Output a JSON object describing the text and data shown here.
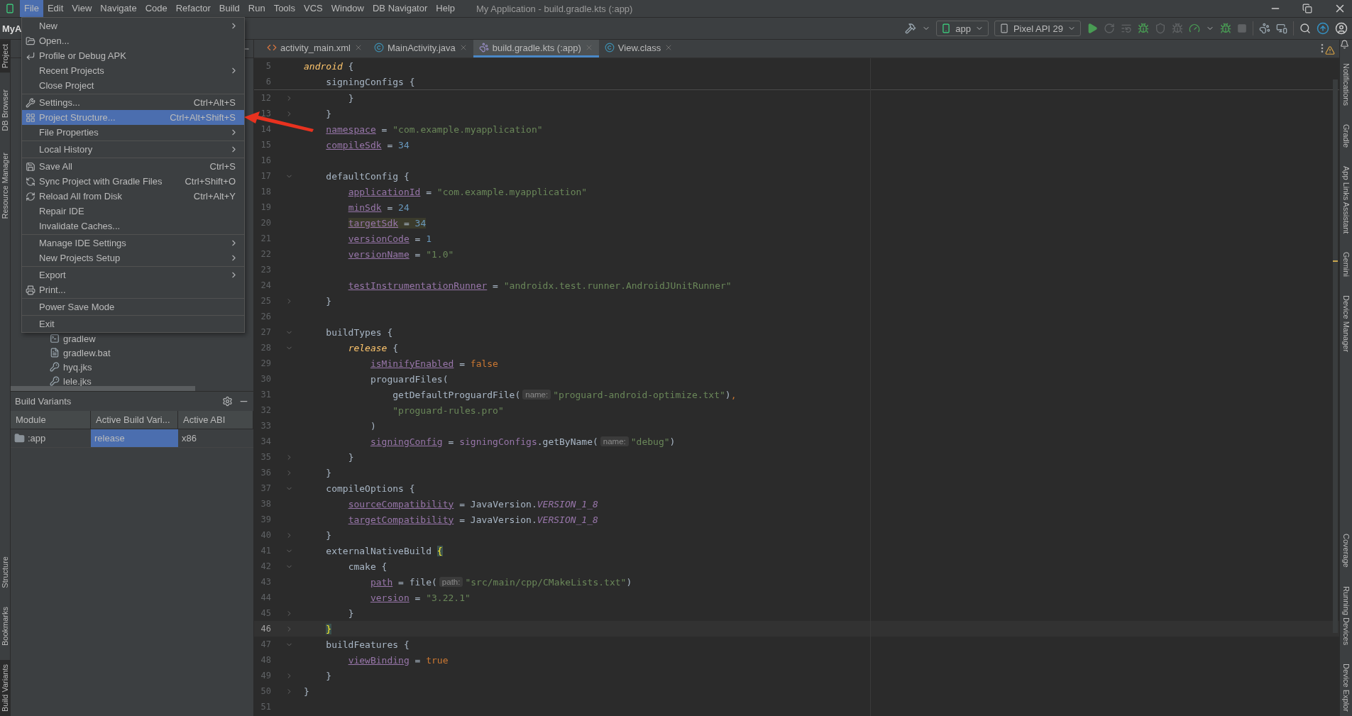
{
  "menu_bar": {
    "items": [
      {
        "label": "File",
        "selected": true
      },
      {
        "label": "Edit",
        "selected": false
      },
      {
        "label": "View",
        "selected": false
      },
      {
        "label": "Navigate",
        "selected": false
      },
      {
        "label": "Code",
        "selected": false
      },
      {
        "label": "Refactor",
        "selected": false
      },
      {
        "label": "Build",
        "selected": false
      },
      {
        "label": "Run",
        "selected": false
      },
      {
        "label": "Tools",
        "selected": false
      },
      {
        "label": "VCS",
        "selected": false
      },
      {
        "label": "Window",
        "selected": false
      },
      {
        "label": "DB Navigator",
        "selected": false
      },
      {
        "label": "Help",
        "selected": false
      }
    ],
    "title": "My Application - build.gradle.kts (:app)"
  },
  "toolbar": {
    "project": "MyA",
    "run_config": "app",
    "device": "Pixel API 29"
  },
  "left_tool_strip": {
    "top": [
      {
        "label": "Project",
        "selected": true
      },
      {
        "label": "DB Browser",
        "selected": false
      },
      {
        "label": "Resource Manager",
        "selected": false
      }
    ],
    "bottom": [
      {
        "label": "Structure",
        "selected": false
      },
      {
        "label": "Bookmarks",
        "selected": false
      },
      {
        "label": "Build Variants",
        "selected": true
      }
    ]
  },
  "project_tree": {
    "items": [
      {
        "label": "gradlew",
        "kind": "script"
      },
      {
        "label": "gradlew.bat",
        "kind": "text"
      },
      {
        "label": "hyq.jks",
        "kind": "keystore"
      },
      {
        "label": "lele.jks",
        "kind": "keystore"
      }
    ]
  },
  "build_variants": {
    "title": "Build Variants",
    "columns": [
      "Module",
      "Active Build Vari...",
      "Active ABI"
    ],
    "rows": [
      {
        "module": ":app",
        "variant": "release",
        "abi": "x86",
        "selected": true
      }
    ]
  },
  "file_menu": {
    "groups": [
      [
        {
          "label": "New",
          "submenu": true,
          "selected": false
        },
        {
          "label": "Open...",
          "submenu": false,
          "selected": false
        },
        {
          "label": "Profile or Debug APK",
          "submenu": false,
          "selected": false
        },
        {
          "label": "Recent Projects",
          "submenu": true,
          "selected": false
        },
        {
          "label": "Close Project",
          "submenu": false,
          "selected": false
        }
      ],
      [
        {
          "label": "Settings...",
          "shortcut": "Ctrl+Alt+S",
          "submenu": false,
          "selected": false
        },
        {
          "label": "Project Structure...",
          "shortcut": "Ctrl+Alt+Shift+S",
          "submenu": false,
          "selected": true
        },
        {
          "label": "File Properties",
          "submenu": true,
          "selected": false
        }
      ],
      [
        {
          "label": "Local History",
          "submenu": true,
          "selected": false
        }
      ],
      [
        {
          "label": "Save All",
          "shortcut": "Ctrl+S",
          "submenu": false,
          "selected": false
        },
        {
          "label": "Sync Project with Gradle Files",
          "shortcut": "Ctrl+Shift+O",
          "submenu": false,
          "selected": false
        },
        {
          "label": "Reload All from Disk",
          "shortcut": "Ctrl+Alt+Y",
          "submenu": false,
          "selected": false
        },
        {
          "label": "Repair IDE",
          "submenu": false,
          "selected": false
        },
        {
          "label": "Invalidate Caches...",
          "submenu": false,
          "selected": false
        }
      ],
      [
        {
          "label": "Manage IDE Settings",
          "submenu": true,
          "selected": false
        },
        {
          "label": "New Projects Setup",
          "submenu": true,
          "selected": false
        }
      ],
      [
        {
          "label": "Export",
          "submenu": true,
          "selected": false
        },
        {
          "label": "Print...",
          "submenu": false,
          "selected": false
        }
      ],
      [
        {
          "label": "Power Save Mode",
          "submenu": false,
          "selected": false
        }
      ],
      [
        {
          "label": "Exit",
          "submenu": false,
          "selected": false
        }
      ]
    ]
  },
  "editor": {
    "tabs": [
      {
        "label": "activity_main.xml",
        "kind": "xml",
        "selected": false
      },
      {
        "label": "MainActivity.java",
        "kind": "class",
        "selected": false
      },
      {
        "label": "build.gradle.kts (:app)",
        "kind": "gradle",
        "selected": true
      },
      {
        "label": "View.class",
        "kind": "class",
        "selected": false
      }
    ],
    "sticky_lines": [
      {
        "number": "5",
        "tokens": [
          {
            "kind": "fn",
            "text": "android"
          },
          {
            "kind": "plain",
            "text": " {"
          }
        ]
      },
      {
        "number": "6",
        "tokens": [
          {
            "kind": "plain",
            "text": "    signingConfigs {"
          }
        ]
      }
    ],
    "lines": [
      {
        "number": "12",
        "kind": "close",
        "tokens": [
          {
            "kind": "plain",
            "text": "        }"
          }
        ]
      },
      {
        "number": "13",
        "kind": "close",
        "tokens": [
          {
            "kind": "plain",
            "text": "    }"
          }
        ]
      },
      {
        "number": "14",
        "kind": "plain",
        "tokens": [
          {
            "kind": "prop",
            "text": "    namespace"
          },
          {
            "kind": "plain",
            "text": " = "
          },
          {
            "kind": "str",
            "text": "\"com.example.myapplication\""
          }
        ]
      },
      {
        "number": "15",
        "kind": "plain",
        "tokens": [
          {
            "kind": "prop",
            "text": "    compileSdk"
          },
          {
            "kind": "plain",
            "text": " = "
          },
          {
            "kind": "num",
            "text": "34"
          }
        ]
      },
      {
        "number": "16",
        "kind": "blank"
      },
      {
        "number": "17",
        "kind": "open",
        "tokens": [
          {
            "kind": "plain",
            "text": "    defaultConfig {"
          }
        ]
      },
      {
        "number": "18",
        "kind": "plain",
        "tokens": [
          {
            "kind": "prop",
            "text": "        applicationId"
          },
          {
            "kind": "plain",
            "text": " = "
          },
          {
            "kind": "str",
            "text": "\"com.example.myapplication\""
          }
        ]
      },
      {
        "number": "19",
        "kind": "plain",
        "tokens": [
          {
            "kind": "prop",
            "text": "        minSdk"
          },
          {
            "kind": "plain",
            "text": " = "
          },
          {
            "kind": "num",
            "text": "24"
          }
        ]
      },
      {
        "number": "20",
        "kind": "plain",
        "marked": true,
        "tokens": [
          {
            "kind": "prop",
            "text": "        targetSdk"
          },
          {
            "kind": "plain",
            "text": " = "
          },
          {
            "kind": "num",
            "text": "34"
          }
        ]
      },
      {
        "number": "21",
        "kind": "plain",
        "tokens": [
          {
            "kind": "prop",
            "text": "        versionCode"
          },
          {
            "kind": "plain",
            "text": " = "
          },
          {
            "kind": "num",
            "text": "1"
          }
        ]
      },
      {
        "number": "22",
        "kind": "plain",
        "tokens": [
          {
            "kind": "prop",
            "text": "        versionName"
          },
          {
            "kind": "plain",
            "text": " = "
          },
          {
            "kind": "str",
            "text": "\"1.0\""
          }
        ]
      },
      {
        "number": "23",
        "kind": "blank"
      },
      {
        "number": "24",
        "kind": "plain",
        "tokens": [
          {
            "kind": "prop",
            "text": "        testInstrumentationRunner"
          },
          {
            "kind": "plain",
            "text": " = "
          },
          {
            "kind": "str",
            "text": "\"androidx.test.runner.AndroidJUnitRunner\""
          }
        ]
      },
      {
        "number": "25",
        "kind": "close",
        "tokens": [
          {
            "kind": "plain",
            "text": "    }"
          }
        ]
      },
      {
        "number": "26",
        "kind": "blank"
      },
      {
        "number": "27",
        "kind": "open",
        "tokens": [
          {
            "kind": "plain",
            "text": "    buildTypes {"
          }
        ]
      },
      {
        "number": "28",
        "kind": "open",
        "tokens": [
          {
            "kind": "fn",
            "text": "        release"
          },
          {
            "kind": "plain",
            "text": " {"
          }
        ]
      },
      {
        "number": "29",
        "kind": "plain",
        "tokens": [
          {
            "kind": "prop",
            "text": "            isMinifyEnabled"
          },
          {
            "kind": "plain",
            "text": " = "
          },
          {
            "kind": "kw",
            "text": "false"
          }
        ]
      },
      {
        "number": "30",
        "kind": "plain",
        "tokens": [
          {
            "kind": "plain",
            "text": "            proguardFiles("
          }
        ]
      },
      {
        "number": "31",
        "kind": "plain",
        "tokens": [
          {
            "kind": "plain",
            "text": "                getDefaultProguardFile("
          },
          {
            "kind": "hint",
            "text": "name:"
          },
          {
            "kind": "str",
            "text": "\"proguard-android-optimize.txt\""
          },
          {
            "kind": "plain",
            "text": ")"
          },
          {
            "kind": "kw",
            "text": ","
          }
        ]
      },
      {
        "number": "32",
        "kind": "plain",
        "tokens": [
          {
            "kind": "str",
            "text": "                \"proguard-rules.pro\""
          }
        ]
      },
      {
        "number": "33",
        "kind": "plain",
        "tokens": [
          {
            "kind": "plain",
            "text": "            )"
          }
        ]
      },
      {
        "number": "34",
        "kind": "plain",
        "tokens": [
          {
            "kind": "prop",
            "text": "            signingConfig"
          },
          {
            "kind": "plain",
            "text": " = "
          },
          {
            "kind": "field",
            "text": "signingConfigs"
          },
          {
            "kind": "plain",
            "text": ".getByName("
          },
          {
            "kind": "hint",
            "text": "name:"
          },
          {
            "kind": "str",
            "text": "\"debug\""
          },
          {
            "kind": "plain",
            "text": ")"
          }
        ]
      },
      {
        "number": "35",
        "kind": "close",
        "tokens": [
          {
            "kind": "plain",
            "text": "        }"
          }
        ]
      },
      {
        "number": "36",
        "kind": "close",
        "tokens": [
          {
            "kind": "plain",
            "text": "    }"
          }
        ]
      },
      {
        "number": "37",
        "kind": "open",
        "tokens": [
          {
            "kind": "plain",
            "text": "    compileOptions {"
          }
        ]
      },
      {
        "number": "38",
        "kind": "plain",
        "tokens": [
          {
            "kind": "prop",
            "text": "        sourceCompatibility"
          },
          {
            "kind": "plain",
            "text": " = JavaVersion."
          },
          {
            "kind": "const",
            "text": "VERSION_1_8"
          }
        ]
      },
      {
        "number": "39",
        "kind": "plain",
        "tokens": [
          {
            "kind": "prop",
            "text": "        targetCompatibility"
          },
          {
            "kind": "plain",
            "text": " = JavaVersion."
          },
          {
            "kind": "const",
            "text": "VERSION_1_8"
          }
        ]
      },
      {
        "number": "40",
        "kind": "close",
        "tokens": [
          {
            "kind": "plain",
            "text": "    }"
          }
        ]
      },
      {
        "number": "41",
        "kind": "open",
        "tokens": [
          {
            "kind": "plain",
            "text": "    externalNativeBuild "
          },
          {
            "kind": "brace",
            "text": "{"
          }
        ]
      },
      {
        "number": "42",
        "kind": "open",
        "tokens": [
          {
            "kind": "plain",
            "text": "        cmake {"
          }
        ]
      },
      {
        "number": "43",
        "kind": "plain",
        "tokens": [
          {
            "kind": "prop",
            "text": "            path"
          },
          {
            "kind": "plain",
            "text": " = file("
          },
          {
            "kind": "hint",
            "text": "path:"
          },
          {
            "kind": "str",
            "text": "\"src/main/cpp/CMakeLists.txt\""
          },
          {
            "kind": "plain",
            "text": ")"
          }
        ]
      },
      {
        "number": "44",
        "kind": "plain",
        "tokens": [
          {
            "kind": "prop",
            "text": "            version"
          },
          {
            "kind": "plain",
            "text": " = "
          },
          {
            "kind": "str",
            "text": "\"3.22.1\""
          }
        ]
      },
      {
        "number": "45",
        "kind": "close",
        "tokens": [
          {
            "kind": "plain",
            "text": "        }"
          }
        ]
      },
      {
        "number": "46",
        "kind": "close",
        "current": true,
        "tokens": [
          {
            "kind": "brace",
            "text": "    }"
          }
        ]
      },
      {
        "number": "47",
        "kind": "open",
        "tokens": [
          {
            "kind": "plain",
            "text": "    buildFeatures {"
          }
        ]
      },
      {
        "number": "48",
        "kind": "plain",
        "tokens": [
          {
            "kind": "prop",
            "text": "        viewBinding"
          },
          {
            "kind": "plain",
            "text": " = "
          },
          {
            "kind": "kw",
            "text": "true"
          }
        ]
      },
      {
        "number": "49",
        "kind": "close",
        "tokens": [
          {
            "kind": "plain",
            "text": "    }"
          }
        ]
      },
      {
        "number": "50",
        "kind": "close",
        "tokens": [
          {
            "kind": "plain",
            "text": "}"
          }
        ]
      },
      {
        "number": "51",
        "kind": "blank"
      }
    ]
  },
  "right_tool_strip": {
    "top": [
      {
        "label": "Notifications"
      },
      {
        "label": "Gradle"
      },
      {
        "label": "App Links Assistant"
      },
      {
        "label": "Gemini"
      },
      {
        "label": "Device Manager"
      }
    ],
    "bottom": [
      {
        "label": "Coverage"
      },
      {
        "label": "Running Devices"
      },
      {
        "label": "Device Explor"
      }
    ]
  }
}
